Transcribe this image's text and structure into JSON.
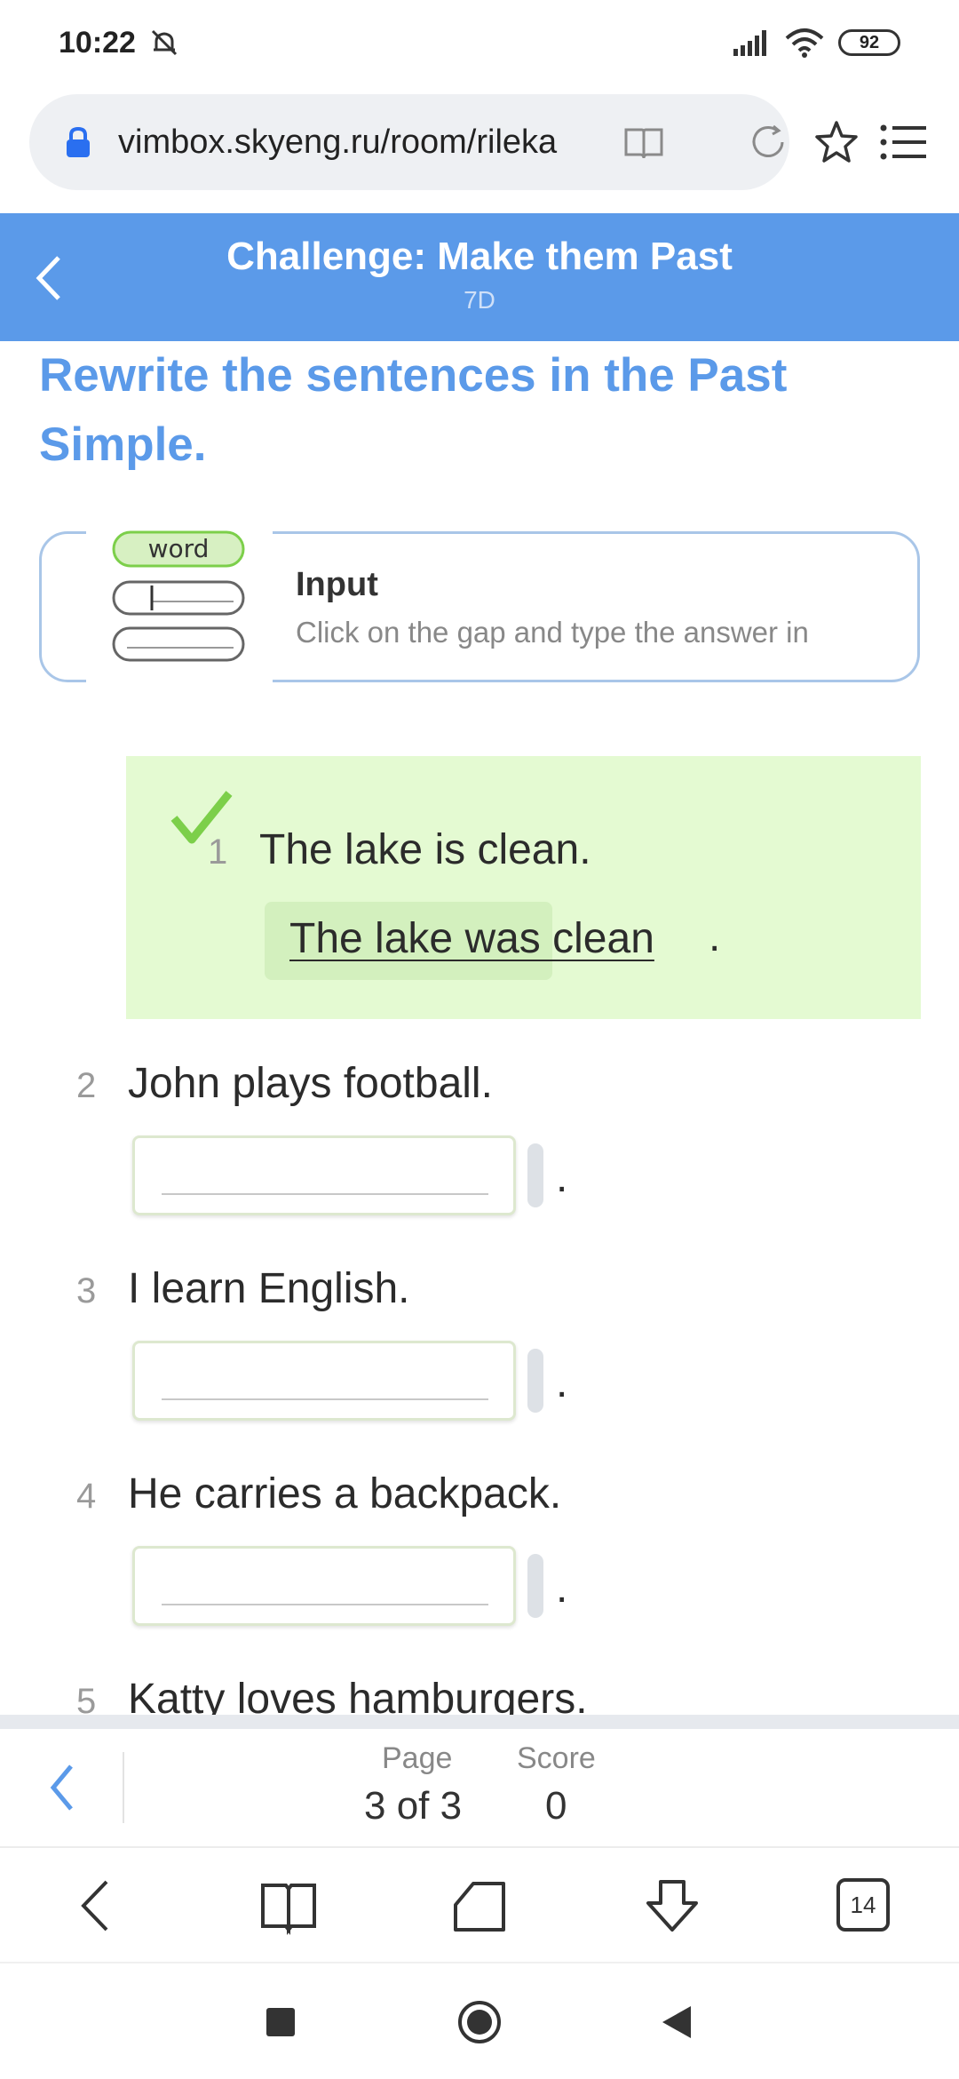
{
  "status_bar": {
    "time": "10:22",
    "battery": "92"
  },
  "browser": {
    "url": "vimbox.skyeng.ru/room/rileka",
    "tabs_count": "14"
  },
  "header": {
    "title": "Challenge: Make them Past",
    "subtitle": "7D"
  },
  "task": {
    "title": "Rewrite the sentences in the Past Simple."
  },
  "input_card": {
    "illustration_word": "word",
    "title": "Input",
    "description": "Click on the gap and type the answer in"
  },
  "questions": [
    {
      "num": "1",
      "text": "The lake is clean.",
      "answer": "The lake was clean",
      "punct": "."
    },
    {
      "num": "2",
      "text": "John plays football.",
      "answer": "",
      "punct": "."
    },
    {
      "num": "3",
      "text": "I learn English.",
      "answer": "",
      "punct": "."
    },
    {
      "num": "4",
      "text": "He carries a backpack.",
      "answer": "",
      "punct": "."
    },
    {
      "num": "5",
      "text": "Katty loves hamburgers."
    }
  ],
  "pager": {
    "page_label": "Page",
    "page_value": "3 of 3",
    "score_label": "Score",
    "score_value": "0"
  },
  "colors": {
    "accent": "#5b9ae9",
    "correct_bg": "#e4fad2",
    "correct_check": "#7ccf4a"
  }
}
